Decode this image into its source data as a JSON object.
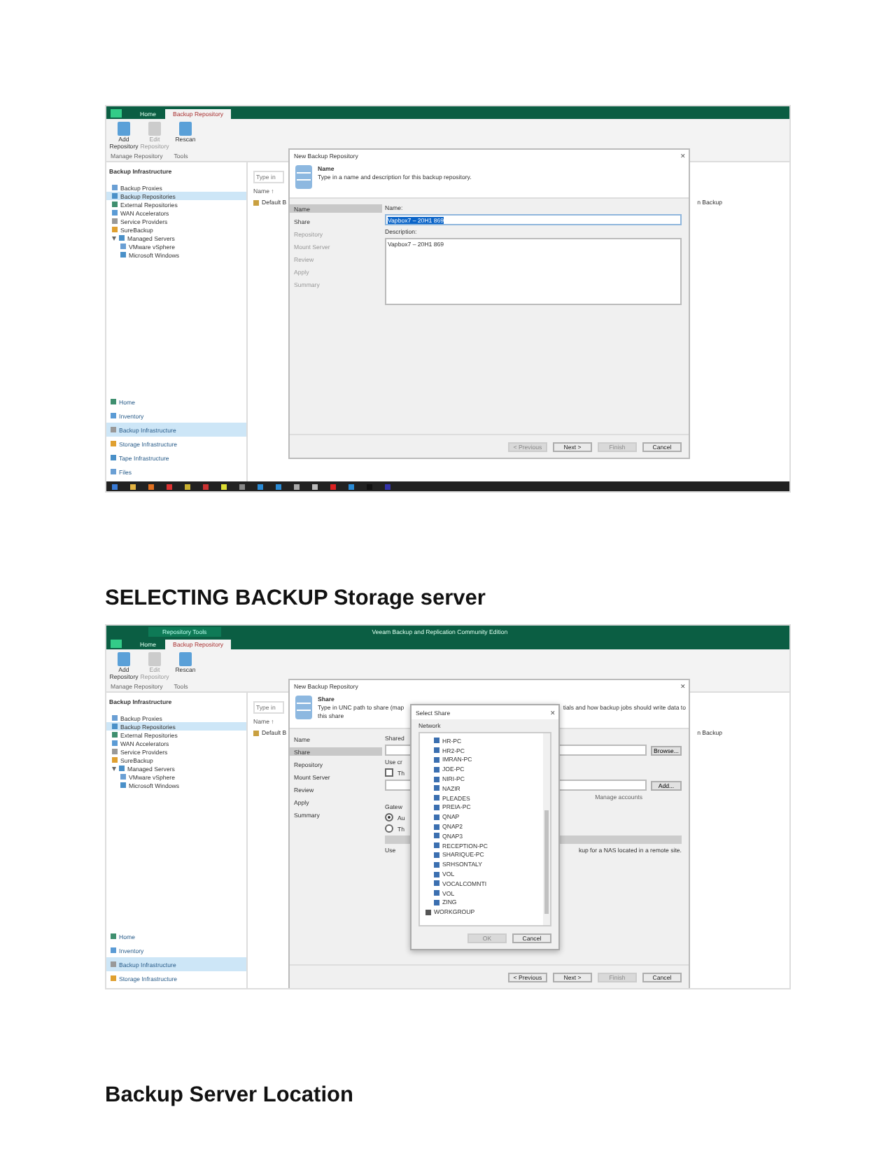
{
  "blocks": [
    {
      "kind": "screenshot",
      "taskbar": true,
      "tabs": [
        {
          "label": "Home",
          "selected": false
        },
        {
          "label": "Backup Repository",
          "selected": true
        }
      ],
      "ribbon": {
        "buttons": [
          {
            "label": "Add Repository",
            "disabled": false
          },
          {
            "label": "Edit Repository",
            "disabled": true
          },
          {
            "label": "Rescan",
            "disabled": false
          }
        ],
        "groups": [
          "Manage Repository",
          "Tools"
        ]
      },
      "nav": {
        "title": "Backup Infrastructure",
        "tree": [
          {
            "label": "Backup Proxies",
            "selected": false
          },
          {
            "label": "Backup Repositories",
            "selected": true
          },
          {
            "label": "External Repositories",
            "selected": false
          },
          {
            "label": "WAN Accelerators",
            "selected": false
          },
          {
            "label": "Service Providers",
            "selected": false
          },
          {
            "label": "SureBackup",
            "selected": false
          },
          {
            "label": "Managed Servers",
            "selected": false,
            "expanded": true,
            "children": [
              {
                "label": "VMware vSphere",
                "selected": false
              },
              {
                "label": "Microsoft Windows",
                "selected": false
              }
            ]
          }
        ],
        "sections": [
          {
            "label": "Home",
            "selected": false
          },
          {
            "label": "Inventory",
            "selected": false
          },
          {
            "label": "Backup Infrastructure",
            "selected": true
          },
          {
            "label": "Storage Infrastructure",
            "selected": false
          },
          {
            "label": "Tape Infrastructure",
            "selected": false
          },
          {
            "label": "Files",
            "selected": false
          }
        ]
      },
      "main": {
        "search_placeholder": "Type in",
        "column": "Name ↑",
        "row": "Default B",
        "right_text": "n Backup"
      },
      "dialog": {
        "kind": "name",
        "title": "New Backup Repository",
        "close": "✕",
        "step_title": "Name",
        "description_lines": [
          "Type in a name and description for this backup repository."
        ],
        "steps": [
          {
            "label": "Name",
            "selected": true,
            "disabled": false
          },
          {
            "label": "Share",
            "selected": false,
            "disabled": false
          },
          {
            "label": "Repository",
            "selected": false,
            "disabled": true
          },
          {
            "label": "Mount Server",
            "selected": false,
            "disabled": true
          },
          {
            "label": "Review",
            "selected": false,
            "disabled": true
          },
          {
            "label": "Apply",
            "selected": false,
            "disabled": true
          },
          {
            "label": "Summary",
            "selected": false,
            "disabled": true
          }
        ],
        "name_label": "Name:",
        "name_value": "Vapbox7 – 20H1 869",
        "description_label": "Description:",
        "description_value": "Vapbox7 – 20H1 869",
        "buttons": [
          {
            "label": "< Previous",
            "disabled": true
          },
          {
            "label": "Next >",
            "disabled": false
          },
          {
            "label": "Finish",
            "disabled": true
          },
          {
            "label": "Cancel",
            "disabled": false
          }
        ]
      }
    },
    {
      "kind": "heading",
      "text": "SELECTING BACKUP Storage server"
    },
    {
      "kind": "screenshot",
      "taskbar": false,
      "context_tab": "Repository Tools",
      "app_title": "Veeam Backup and Replication Community Edition",
      "tabs": [
        {
          "label": "Home",
          "selected": false
        },
        {
          "label": "Backup Repository",
          "selected": true
        }
      ],
      "ribbon": {
        "buttons": [
          {
            "label": "Add Repository",
            "disabled": false
          },
          {
            "label": "Edit Repository",
            "disabled": true
          },
          {
            "label": "Rescan",
            "disabled": false
          }
        ],
        "groups": [
          "Manage Repository",
          "Tools"
        ]
      },
      "nav": {
        "title": "Backup Infrastructure",
        "tree": [
          {
            "label": "Backup Proxies",
            "selected": false
          },
          {
            "label": "Backup Repositories",
            "selected": true
          },
          {
            "label": "External Repositories",
            "selected": false
          },
          {
            "label": "WAN Accelerators",
            "selected": false
          },
          {
            "label": "Service Providers",
            "selected": false
          },
          {
            "label": "SureBackup",
            "selected": false
          },
          {
            "label": "Managed Servers",
            "selected": false,
            "expanded": true,
            "children": [
              {
                "label": "VMware vSphere",
                "selected": false
              },
              {
                "label": "Microsoft Windows",
                "selected": false
              }
            ]
          }
        ],
        "sections": [
          {
            "label": "Home",
            "selected": false
          },
          {
            "label": "Inventory",
            "selected": false
          },
          {
            "label": "Backup Infrastructure",
            "selected": true
          },
          {
            "label": "Storage Infrastructure",
            "selected": false
          }
        ]
      },
      "main": {
        "search_placeholder": "Type in",
        "column": "Name ↑",
        "row": "Default B",
        "right_text": "n Backup"
      },
      "dialog": {
        "kind": "share",
        "title": "New Backup Repository",
        "close": "✕",
        "step_title": "Share",
        "description_lines": [
          "Type in UNC path to share (map",
          "this share"
        ],
        "description_tail": "tials and how backup jobs should write data to",
        "steps": [
          {
            "label": "Name",
            "selected": false,
            "disabled": false
          },
          {
            "label": "Share",
            "selected": true,
            "disabled": false
          },
          {
            "label": "Repository",
            "selected": false,
            "disabled": false
          },
          {
            "label": "Mount Server",
            "selected": false,
            "disabled": false
          },
          {
            "label": "Review",
            "selected": false,
            "disabled": false
          },
          {
            "label": "Apply",
            "selected": false,
            "disabled": false
          },
          {
            "label": "Summary",
            "selected": false,
            "disabled": false
          }
        ],
        "shared_label": "Shared",
        "browse": "Browse...",
        "credentials_label": "Use cr",
        "checkbox": {
          "label": "Th",
          "checked": false
        },
        "add": "Add...",
        "manage_link": "Manage accounts",
        "gateway_label": "Gatew",
        "radios": [
          {
            "label": "Au",
            "selected": true
          },
          {
            "label": "Th",
            "selected": false
          }
        ],
        "note_left": "Use",
        "note_right": "kup for a NAS located in a remote site.",
        "buttons": [
          {
            "label": "< Previous",
            "disabled": false
          },
          {
            "label": "Next >",
            "disabled": false
          },
          {
            "label": "Finish",
            "disabled": true
          },
          {
            "label": "Cancel",
            "disabled": false
          }
        ],
        "popup": {
          "title": "Select Share",
          "close": "✕",
          "label": "Network",
          "items": [
            {
              "kind": "group",
              "children": [
                {
                  "label": "HR-PC",
                  "kind": "computer"
                },
                {
                  "label": "HR2-PC",
                  "kind": "computer"
                },
                {
                  "label": "IMRAN-PC",
                  "kind": "computer"
                },
                {
                  "label": "JOE-PC",
                  "kind": "computer"
                },
                {
                  "label": "NIRI-PC",
                  "kind": "computer"
                },
                {
                  "label": "NAZIR",
                  "kind": "computer"
                },
                {
                  "label": "PLEADES",
                  "kind": "computer"
                },
                {
                  "label": "PREIA-PC",
                  "kind": "computer"
                },
                {
                  "label": "QNAP",
                  "kind": "computer"
                },
                {
                  "label": "QNAP2",
                  "kind": "computer"
                },
                {
                  "label": "QNAP3",
                  "kind": "computer"
                },
                {
                  "label": "RECEPTION-PC",
                  "kind": "computer"
                },
                {
                  "label": "SHARIQUE-PC",
                  "kind": "computer"
                },
                {
                  "label": "SRHSONTALY",
                  "kind": "computer"
                },
                {
                  "label": "VOL",
                  "kind": "computer"
                },
                {
                  "label": "VOCALCOMNTI",
                  "kind": "computer"
                },
                {
                  "label": "VOL",
                  "kind": "computer"
                },
                {
                  "label": "ZING",
                  "kind": "computer"
                }
              ]
            },
            {
              "label": "WORKGROUP",
              "kind": "workgroup"
            }
          ],
          "buttons": [
            {
              "label": "OK",
              "disabled": true
            },
            {
              "label": "Cancel",
              "disabled": false
            }
          ]
        }
      }
    },
    {
      "kind": "heading",
      "text": "Backup Server Location"
    }
  ]
}
